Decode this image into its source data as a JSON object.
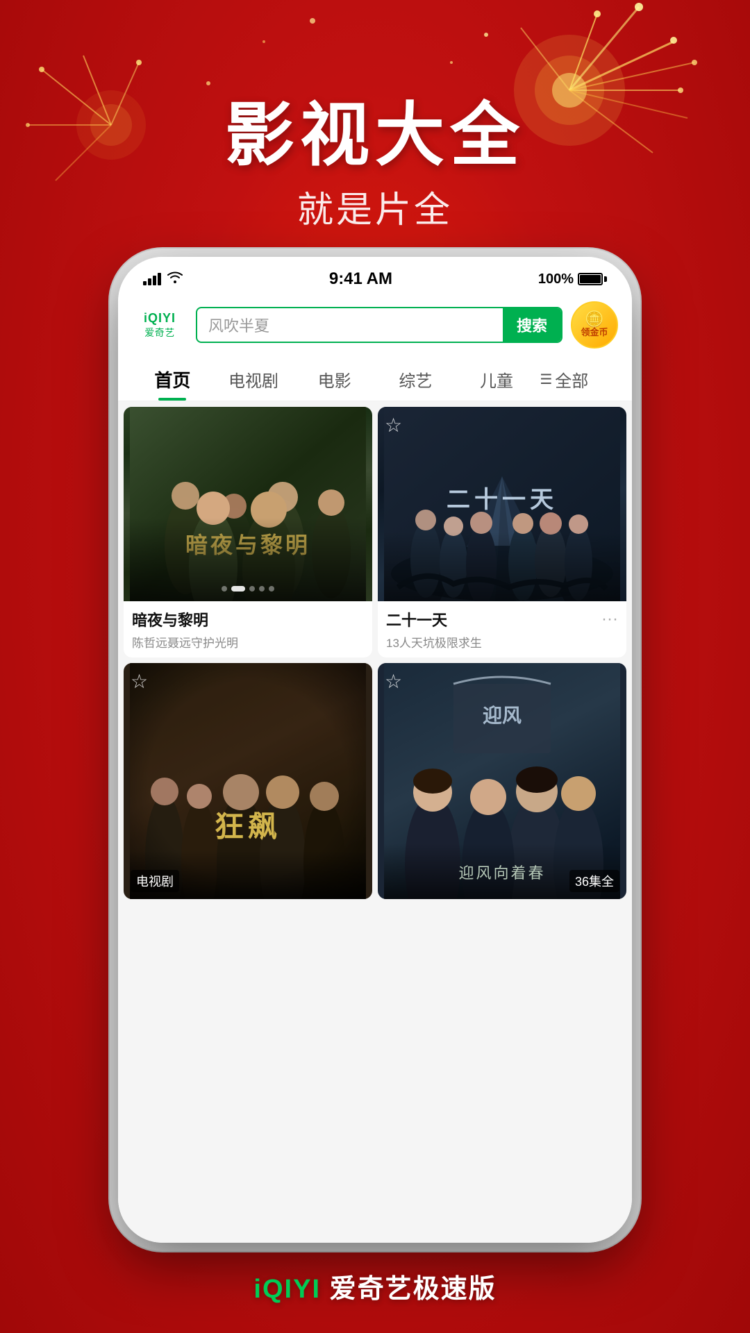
{
  "app": {
    "background_color": "#c01010",
    "headline_main": "影视大全",
    "headline_sub": "就是片全",
    "footer_brand": "iQIYI 爱奇艺极速版"
  },
  "status_bar": {
    "time": "9:41 AM",
    "battery": "100%",
    "signal_bars": 4,
    "wifi": true
  },
  "header": {
    "logo_top": "iQIYI",
    "logo_bottom": "爱奇艺",
    "search_placeholder": "风吹半夏",
    "search_button": "搜索",
    "gold_coin_label": "领金币"
  },
  "nav_tabs": [
    {
      "id": "home",
      "label": "首页",
      "active": true
    },
    {
      "id": "tv",
      "label": "电视剧",
      "active": false
    },
    {
      "id": "movie",
      "label": "电影",
      "active": false
    },
    {
      "id": "variety",
      "label": "综艺",
      "active": false
    },
    {
      "id": "kids",
      "label": "儿童",
      "active": false
    },
    {
      "id": "all",
      "label": "全部",
      "active": false
    }
  ],
  "content": {
    "featured_left": {
      "title": "暗夜与黎明",
      "subtitle": "陈哲远聂远守护光明",
      "pagination": [
        false,
        true,
        false,
        false,
        false
      ]
    },
    "featured_right": {
      "title": "二十一天",
      "subtitle": "13人天坑极限求生",
      "has_star": true,
      "has_more": true
    },
    "bottom_left": {
      "title": "狂飙",
      "badge": "电视剧",
      "has_star": true
    },
    "bottom_right": {
      "title": "迎风",
      "badge": "36集全",
      "has_star": true
    }
  },
  "icons": {
    "star": "☆",
    "star_filled": "★",
    "menu": "☰",
    "more": "···",
    "search": "搜索"
  }
}
